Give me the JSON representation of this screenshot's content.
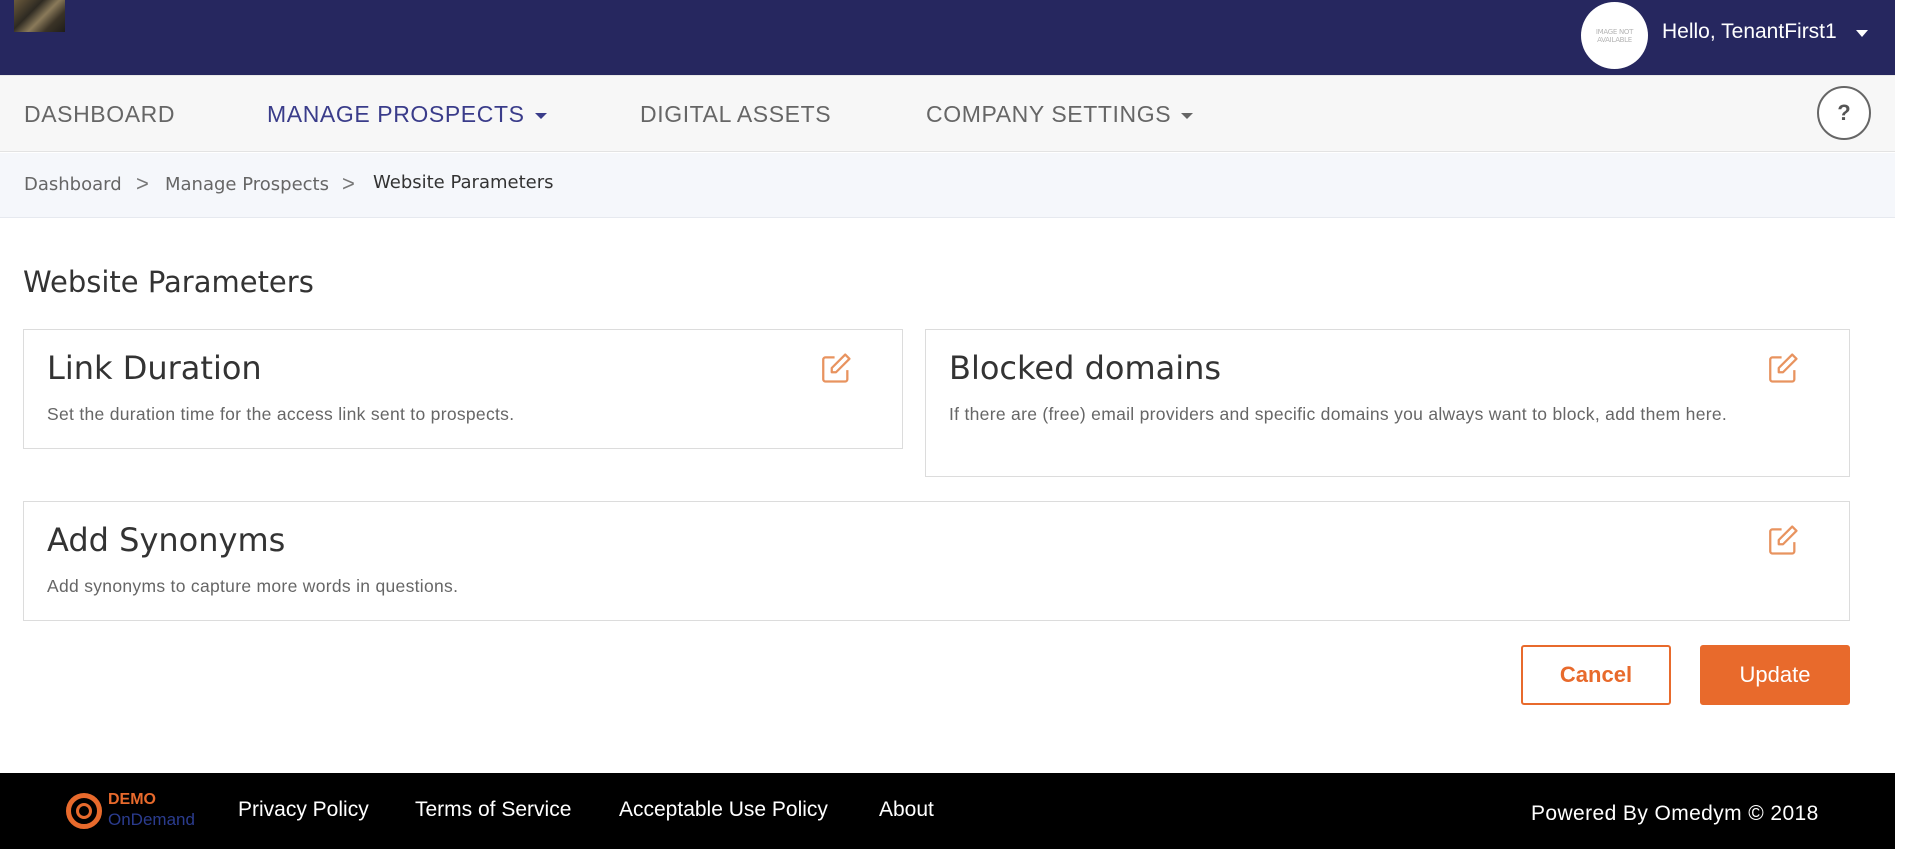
{
  "header": {
    "avatar_text": "IMAGE NOT AVAILABLE",
    "greeting": "Hello, TenantFirst1"
  },
  "nav": {
    "items": [
      {
        "label": "DASHBOARD"
      },
      {
        "label": "MANAGE PROSPECTS"
      },
      {
        "label": "DIGITAL ASSETS"
      },
      {
        "label": "COMPANY SETTINGS"
      }
    ],
    "help_label": "?"
  },
  "breadcrumb": {
    "items": [
      "Dashboard",
      "Manage Prospects",
      "Website Parameters"
    ],
    "separator": ">"
  },
  "main": {
    "title": "Website Parameters",
    "cards": [
      {
        "title": "Link Duration",
        "description": "Set the duration time for the access link sent to prospects."
      },
      {
        "title": "Blocked domains",
        "description": "If there are (free) email providers and specific domains you always want to block, add them here."
      },
      {
        "title": "Add Synonyms",
        "description": "Add synonyms to capture more words in questions."
      }
    ],
    "cancel_label": "Cancel",
    "update_label": "Update"
  },
  "footer": {
    "logo_line1": "DEMO",
    "logo_line2": "OnDemand",
    "links": [
      "Privacy Policy",
      "Terms of Service",
      "Acceptable Use Policy",
      "About"
    ],
    "powered": "Powered By Omedym © 2018"
  },
  "colors": {
    "header_bg": "#26275f",
    "accent": "#e86a2c",
    "nav_active": "#3a3c8a"
  }
}
